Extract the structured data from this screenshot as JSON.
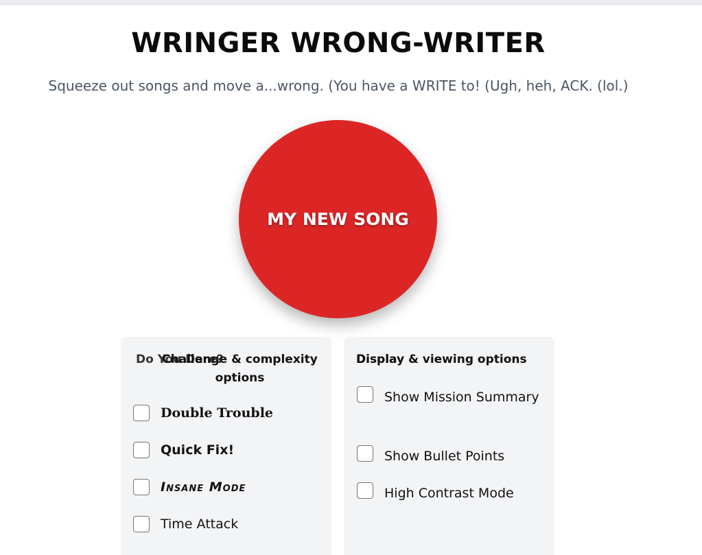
{
  "header": {
    "title": "WRINGER WRONG-WRITER",
    "subtitle": "Squeeze out songs and move a...wrong. (You have a WRITE to! (Ugh, heh, ACK. (lol.)"
  },
  "main_button": {
    "label": "MY NEW SONG"
  },
  "left_panel": {
    "heading_back": "Do You Dare?",
    "heading_front": "Challenge & complexity options",
    "options": [
      {
        "label": "Double Trouble",
        "checked": false
      },
      {
        "label": "Quick Fix!",
        "checked": false
      },
      {
        "label": "Insane Mode",
        "checked": false
      },
      {
        "label": "Time Attack",
        "checked": false
      }
    ]
  },
  "right_panel": {
    "heading_back": "Display",
    "heading_front": "Display & viewing options",
    "options": [
      {
        "label": "Show Mission Summary",
        "checked": false
      },
      {
        "label": "Show Bullet Points",
        "checked": false
      },
      {
        "label": "High Contrast Mode",
        "checked": false
      }
    ]
  },
  "colors": {
    "button_red": "#dc2626",
    "panel_bg": "#f3f4f6",
    "subtitle_gray": "#4b5563"
  }
}
